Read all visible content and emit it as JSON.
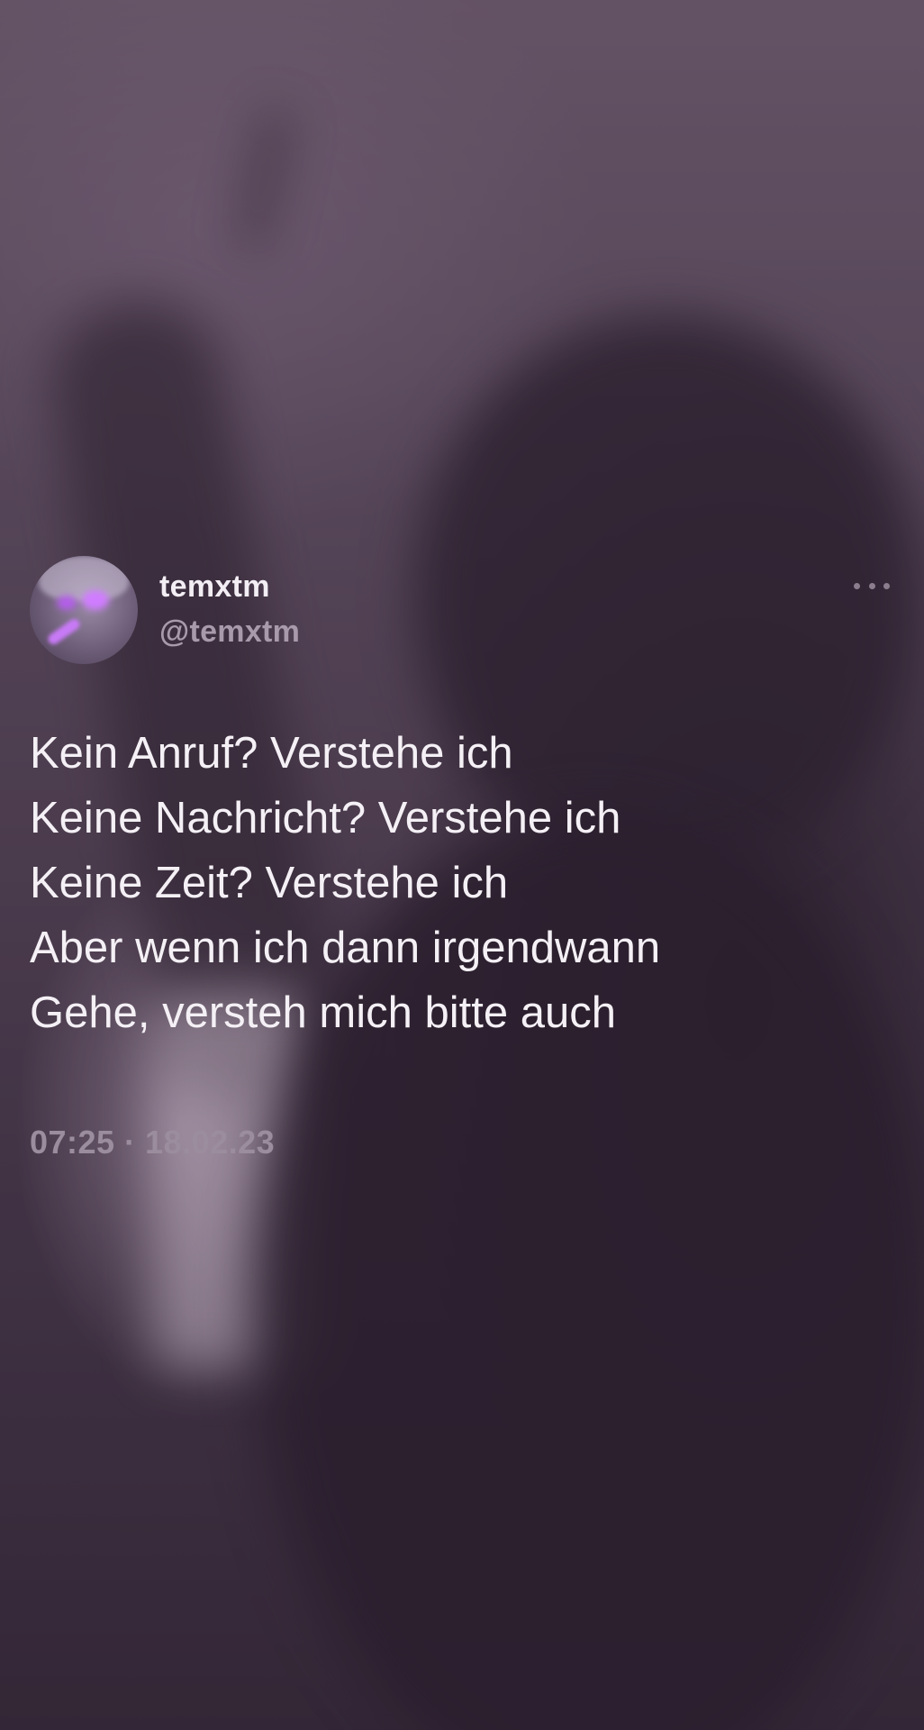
{
  "tweet": {
    "display_name": "temxtm",
    "handle": "@temxtm",
    "lines": [
      "Kein Anruf? Verstehe ich",
      "Keine Nachricht? Verstehe ich",
      "Keine Zeit? Verstehe ich",
      "Aber wenn ich dann irgendwann",
      "Gehe, versteh mich bitte auch"
    ],
    "timestamp": "07:25 · 18.02.23"
  },
  "icons": {
    "more": "more-horizontal-icon",
    "avatar": "avatar-image"
  },
  "colors": {
    "text_primary": "#f4f0f5",
    "text_secondary": "#9b8d9d",
    "background_tint": "#4e4050",
    "avatar_glow": "#d07cff"
  }
}
